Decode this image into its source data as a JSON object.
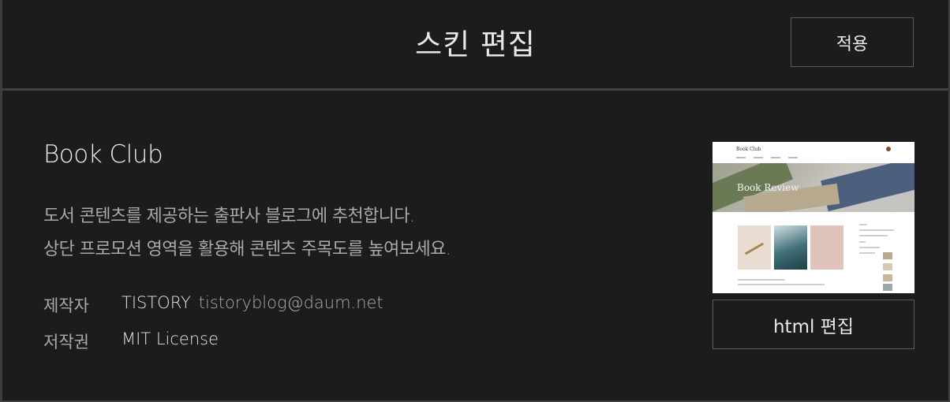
{
  "header": {
    "title": "스킨 편집",
    "apply_label": "적용"
  },
  "skin": {
    "name": "Book Club",
    "description": [
      "도서 콘텐츠를 제공하는 출판사 블로그에 추천합니다.",
      "상단 프로모션 영역을 활용해 콘텐츠 주목도를 높여보세요."
    ],
    "author_label": "제작자",
    "author_name": "TISTORY",
    "author_email": "tistoryblog@daum.net",
    "license_label": "저작권",
    "license_value": "MIT License"
  },
  "preview": {
    "logo_text": "Book Club",
    "banner_title": "Book Review",
    "html_edit_label": "html 편집"
  },
  "colors": {
    "background": "#1b1c1e",
    "border": "#404143",
    "text_primary": "#e8e8e8",
    "text_secondary": "#a9a9aa"
  }
}
